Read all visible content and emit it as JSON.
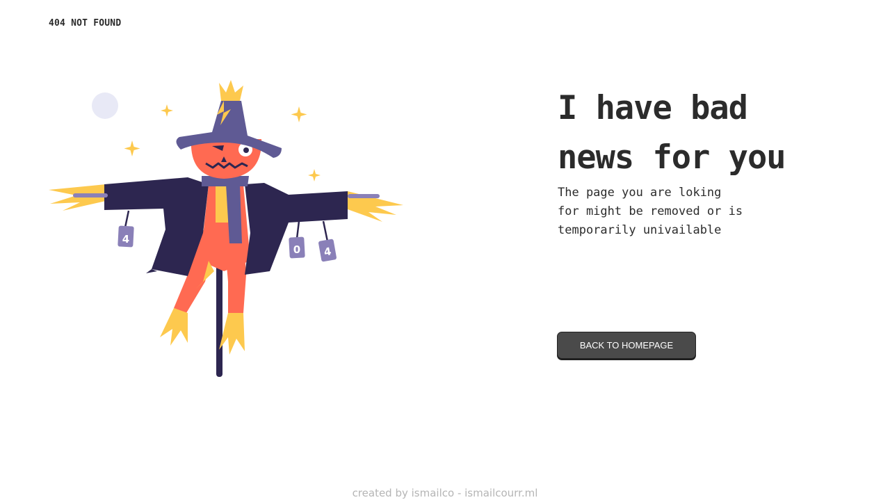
{
  "header": {
    "title": "404 NOT FOUND"
  },
  "main": {
    "headline": "I have bad news for you",
    "message": "The page you are loking for might be removed or is temporarily univailable",
    "button_label": "BACK TO HOMEPAGE"
  },
  "illustration": {
    "can_labels": [
      "4",
      "0",
      "4"
    ]
  },
  "footer": {
    "credit": "created by ismailco - ismailcourr.ml"
  },
  "colors": {
    "text": "#2b2b2b",
    "button_bg": "#4a4a4a",
    "hat": "#5f5a94",
    "coat": "#2d2650",
    "pumpkin": "#ff6a52",
    "straw": "#fdc94e",
    "footer_text": "#b5b5b5"
  }
}
